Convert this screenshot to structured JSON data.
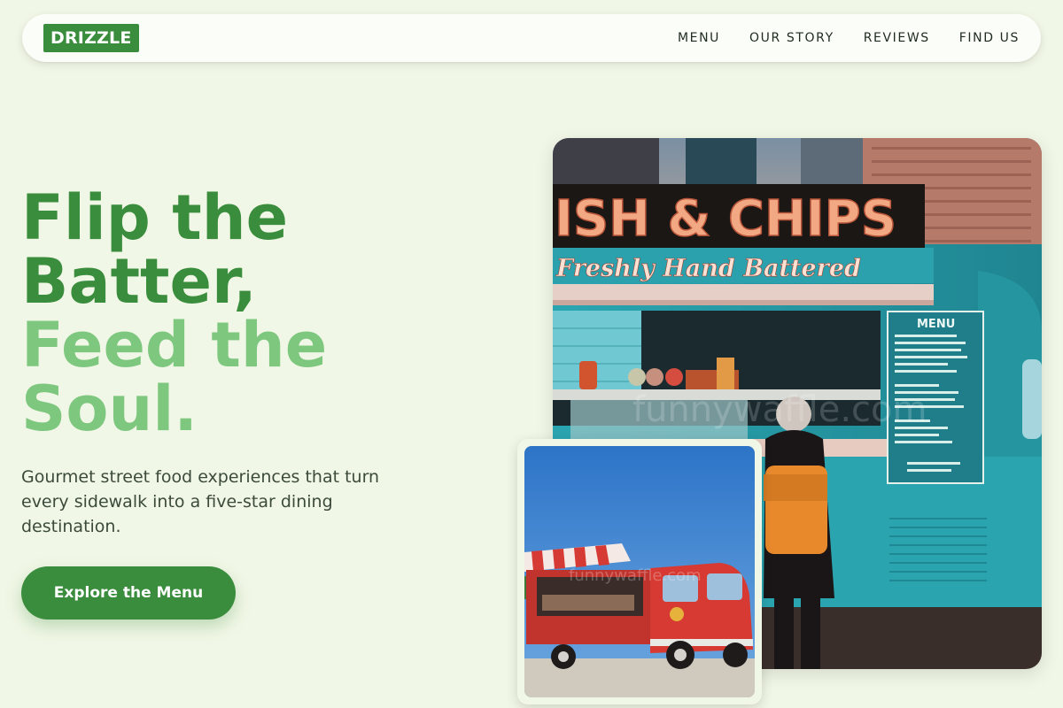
{
  "brand": {
    "logo": "DRIZZLE"
  },
  "nav": {
    "links": [
      "MENU",
      "OUR STORY",
      "REVIEWS",
      "FIND US"
    ]
  },
  "hero": {
    "title_line1": "Flip the",
    "title_line2": "Batter,",
    "title_line3": "Feed the",
    "title_line4": "Soul.",
    "subtitle": "Gourmet street food experiences that turn every sidewalk into a five-star dining destination.",
    "cta_label": "Explore the Menu"
  },
  "images": {
    "main": {
      "sign": "ISH & CHIPS",
      "banner": "Freshly Hand Battered",
      "board_title": "MENU"
    }
  },
  "colors": {
    "brand": "#3a8d3c",
    "brand_light": "#7ec77f",
    "background": "#f1f7e6"
  }
}
